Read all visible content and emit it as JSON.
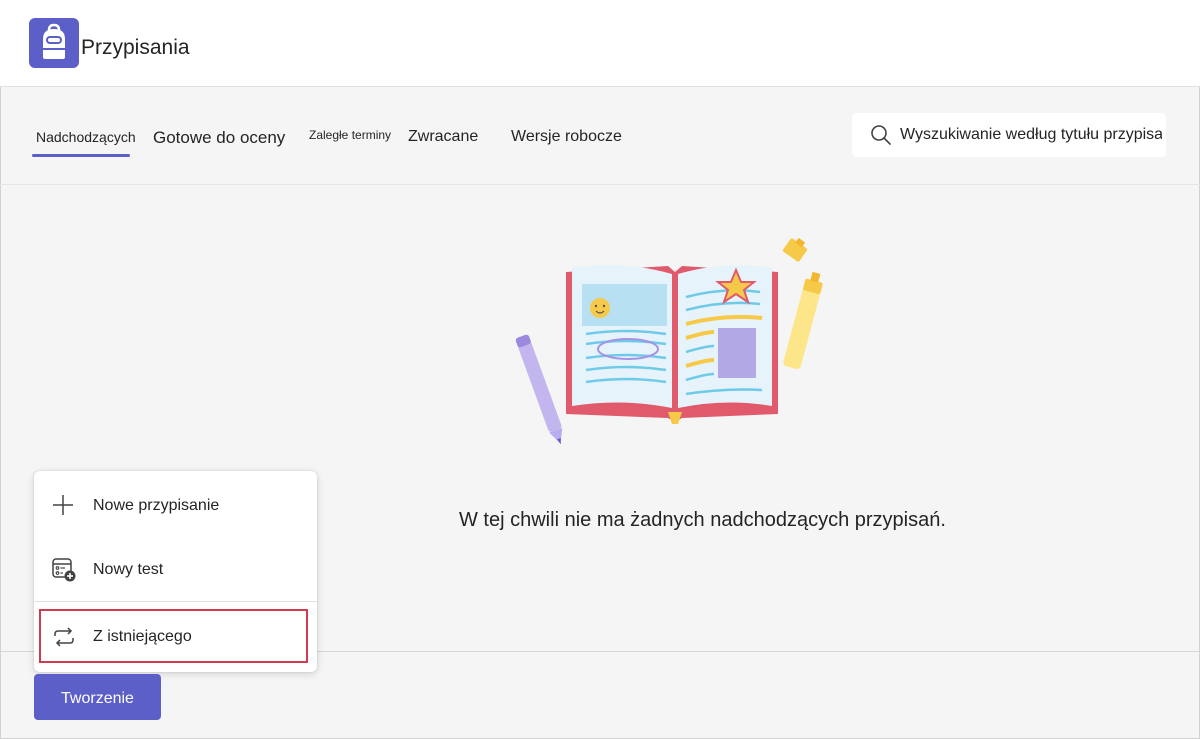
{
  "app": {
    "title": "Przypisania",
    "accent": "#5b5fc7"
  },
  "tabs": [
    {
      "label": "Nadchodzących",
      "selected": true
    },
    {
      "label": "Gotowe do oceny",
      "selected": false
    },
    {
      "label": "Zaległe terminy",
      "selected": false
    },
    {
      "label": "Zwracane",
      "selected": false
    },
    {
      "label": "Wersje robocze",
      "selected": false
    }
  ],
  "search": {
    "placeholder": "Wyszukiwanie według tytułu przypisania",
    "icon": "search-icon"
  },
  "empty_state": {
    "message": "W tej chwili nie ma żadnych nadchodzących przypisań.",
    "illustration": "open-book-illustration"
  },
  "create_menu": {
    "items": [
      {
        "label": "Nowe przypisanie",
        "icon": "plus-icon"
      },
      {
        "label": "Nowy test",
        "icon": "quiz-icon"
      },
      {
        "label": "Z istniejącego",
        "icon": "reuse-icon",
        "highlighted": true
      }
    ],
    "highlight_color": "#d13a4f"
  },
  "create_button": {
    "label": "Tworzenie"
  }
}
